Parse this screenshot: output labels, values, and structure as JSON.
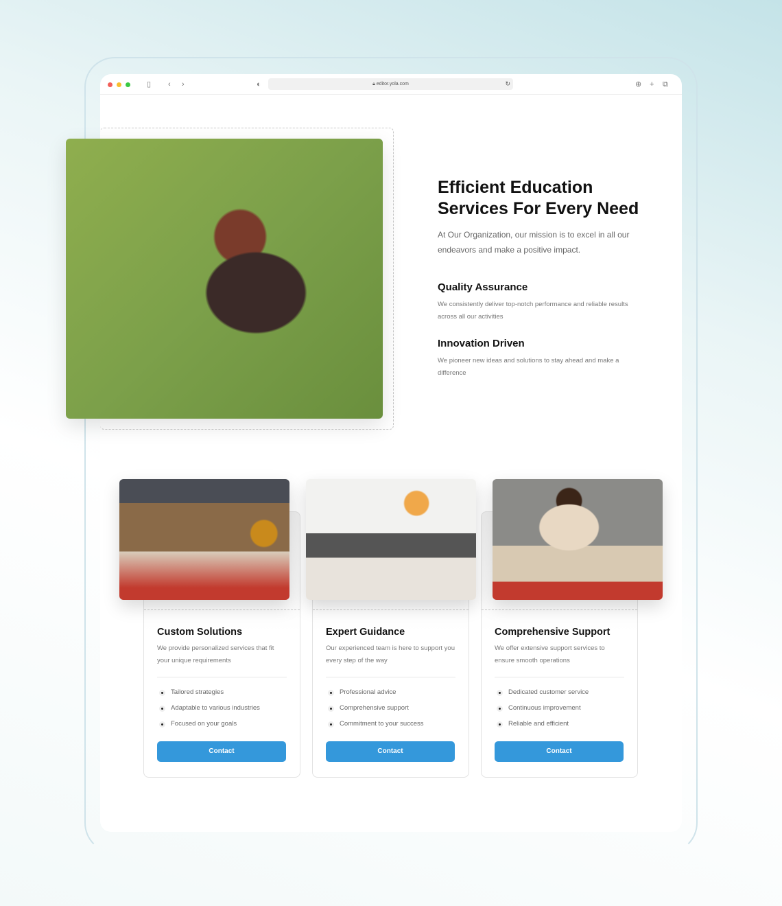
{
  "browser": {
    "url": "editor.yola.com"
  },
  "hero": {
    "title": "Efficient Education Services For Every Need",
    "text": "At Our Organization, our mission is to excel in all our endeavors and make a positive impact.",
    "features": [
      {
        "title": "Quality Assurance",
        "text": "We consistently deliver top-notch performance and reliable results across all our activities"
      },
      {
        "title": "Innovation Driven",
        "text": "We pioneer new ideas and solutions to stay ahead and make a difference"
      }
    ]
  },
  "cards": [
    {
      "title": "Custom Solutions",
      "text": "We provide personalized services that fit your unique requirements",
      "items": [
        "Tailored strategies",
        "Adaptable to various industries",
        "Focused on your goals"
      ],
      "button": "Contact"
    },
    {
      "title": "Expert Guidance",
      "text": "Our experienced team is here to support you every step of the way",
      "items": [
        "Professional advice",
        "Comprehensive support",
        "Commitment to your success"
      ],
      "button": "Contact"
    },
    {
      "title": "Comprehensive Support",
      "text": "We offer extensive support services to ensure smooth operations",
      "items": [
        "Dedicated customer service",
        "Continuous improvement",
        "Reliable and efficient"
      ],
      "button": "Contact"
    }
  ],
  "colors": {
    "accent": "#3498db"
  }
}
